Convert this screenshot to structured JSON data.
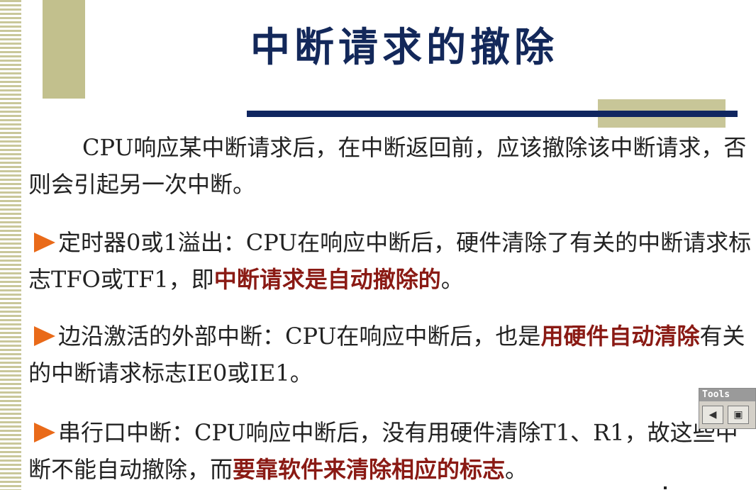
{
  "slide": {
    "title": "中断请求的撤除",
    "paragraphs": [
      {
        "bullet": false,
        "segments": [
          {
            "text": "CPU响应某中断请求后，在中断返回前，应该撤除该中断请求，否则会引起另一次中断。",
            "highlight": false
          }
        ]
      },
      {
        "bullet": true,
        "segments": [
          {
            "text": "定时器0或1溢出：CPU在响应中断后，硬件清除了有关的中断请求标志TFO或TF1，即",
            "highlight": false
          },
          {
            "text": "中断请求是自动撤除的",
            "highlight": true
          },
          {
            "text": "。",
            "highlight": false
          }
        ]
      },
      {
        "bullet": true,
        "segments": [
          {
            "text": "边沿激活的外部中断：CPU在响应中断后，也是",
            "highlight": false
          },
          {
            "text": "用硬件自动清除",
            "highlight": true
          },
          {
            "text": "有关的中断请求标志IE0或IE1。",
            "highlight": false
          }
        ]
      },
      {
        "bullet": true,
        "segments": [
          {
            "text": "串行口中断：CPU响应中断后，没有用硬件清除T1、R1，故这些中断不能自动撤除，而",
            "highlight": false
          },
          {
            "text": "要靠软件来清除相应的标志",
            "highlight": true
          },
          {
            "text": "。",
            "highlight": false
          }
        ]
      }
    ],
    "colors": {
      "title": "#13285a",
      "highlight": "#8a1a14",
      "bullet_arrow": "#e96a19",
      "accent_bar": "#102660",
      "decor": "#c2c08d"
    }
  },
  "tools_panel": {
    "title": "Tools",
    "buttons": [
      {
        "icon": "arrow-left-icon",
        "glyph": "◀"
      },
      {
        "icon": "document-icon",
        "glyph": "▣"
      }
    ]
  }
}
